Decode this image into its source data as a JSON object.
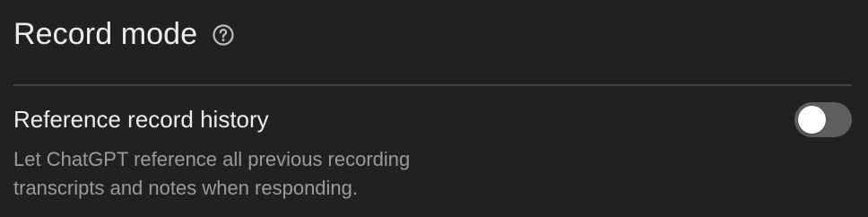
{
  "section": {
    "title": "Record mode",
    "help_icon": "question-circle-icon"
  },
  "setting": {
    "label": "Reference record history",
    "description": "Let ChatGPT reference all previous recording transcripts and notes when responding.",
    "toggle_enabled": false
  },
  "colors": {
    "background": "#212121",
    "text_primary": "#ececec",
    "text_secondary": "#9b9b9b",
    "divider": "#424242",
    "toggle_off_track": "#5e5e5e",
    "toggle_knob": "#ffffff"
  }
}
